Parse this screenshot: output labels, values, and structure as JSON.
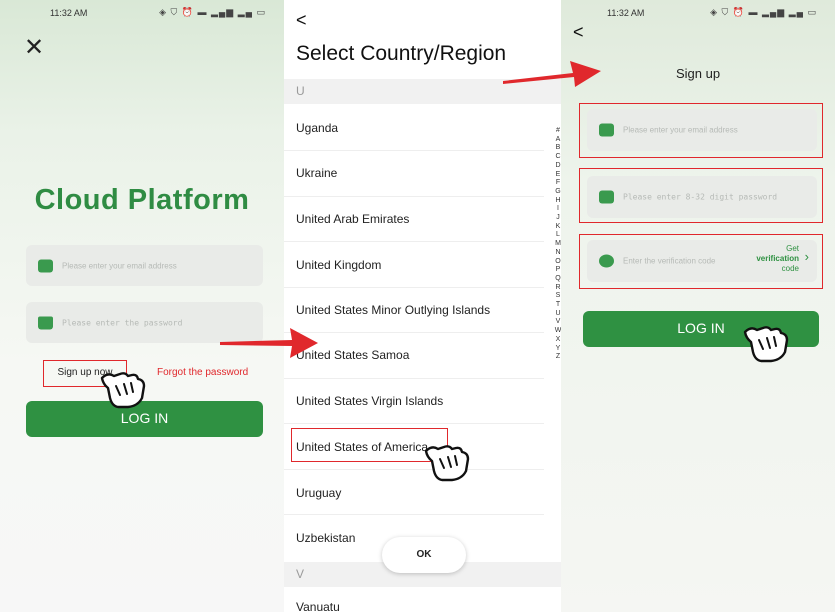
{
  "colors": {
    "brand_green": "#2f8c43",
    "highlight_red": "#e0282c"
  },
  "screen1": {
    "status": {
      "time": "11:32 AM",
      "icons": "◈ ⛉ ⏰ ▬ ▂▄▆ ▂▄ ▭"
    },
    "close_icon": "✕",
    "brand": "Cloud Platform",
    "email_placeholder": "Please enter your email address",
    "password_placeholder": "Please enter the password",
    "sign_up": "Sign up now",
    "forgot": "Forgot the password",
    "login": "LOG IN"
  },
  "screen2": {
    "back_icon": "<",
    "title": "Select Country/Region",
    "section_u": "U",
    "countries": [
      "Uganda",
      "Ukraine",
      "United Arab Emirates",
      "United Kingdom",
      "United States Minor Outlying Islands",
      "United States Samoa",
      "United States Virgin Islands",
      "United States of America",
      "Uruguay",
      "Uzbekistan"
    ],
    "section_v": "V",
    "after_v": "Vanuatu",
    "alphabet": "#ABCDEFGHIJKLMNOPQRSTUVWXYZ",
    "ok": "OK"
  },
  "screen3": {
    "status": {
      "time": "11:32 AM",
      "icons": "◈ ⛉ ⏰ ▬ ▂▄▆ ▂▄ ▭"
    },
    "back_icon": "<",
    "title": "Sign up",
    "email_placeholder": "Please enter your email address",
    "password_placeholder": "Please enter 8-32 digit password",
    "code_placeholder": "Enter the verification code",
    "get_code_1": "Get",
    "get_code_2": "verification",
    "get_code_3": "code",
    "chevron_icon": "›",
    "login": "LOG IN"
  }
}
